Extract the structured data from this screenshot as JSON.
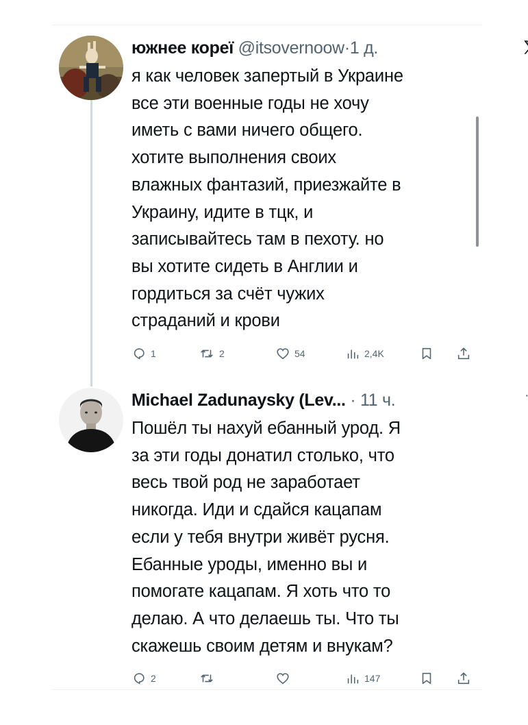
{
  "tweets": [
    {
      "display_name": "южнее кореї",
      "handle": "@itsovernoow",
      "separator": "·",
      "time": "1 д.",
      "text": "я как человек запертый в Украине\nвсе эти военные годы не хочу\nиметь с вами ничего общего.\nхотите выполнения своих\nвлажных фантазий, приезжайте в\nУкраину, идите в тцк, и\nзаписывайтесь там в пехоту. но\nвы хотите сидеть в Англии и\nгордиться за счёт чужих\nстраданий и крови",
      "replies": "1",
      "reposts": "2",
      "likes": "54",
      "views": "2,4K",
      "corner_icon": "x-logo-icon"
    },
    {
      "display_name": "Michael Zadunaysky (Lev...",
      "handle": "",
      "separator": "·",
      "time": "11 ч.",
      "more": "···",
      "text": "Пошёл ты нахуй ебанный урод. Я\nза эти годы донатил столько, что\nвесь твой род не заработает\nникогда. Иди и сдайся кацапам\nесли у тебя внутри живёт русня.\nЕбанные уроды, именно вы и\nпомогате кацапам. Я хоть что то\nделаю. А что делаешь ты. Что ты\nскажешь своим детям и внукам?",
      "replies": "2",
      "reposts": "",
      "likes": "",
      "views": "147",
      "corner_icon": "more-icon"
    }
  ],
  "colors": {
    "text": "#0f1419",
    "secondary": "#536471",
    "thread_line": "#cfd9de",
    "divider": "#eff3f4"
  },
  "icons": [
    "reply-icon",
    "repost-icon",
    "like-icon",
    "views-icon",
    "bookmark-icon",
    "share-icon",
    "x-logo-icon",
    "more-icon"
  ]
}
